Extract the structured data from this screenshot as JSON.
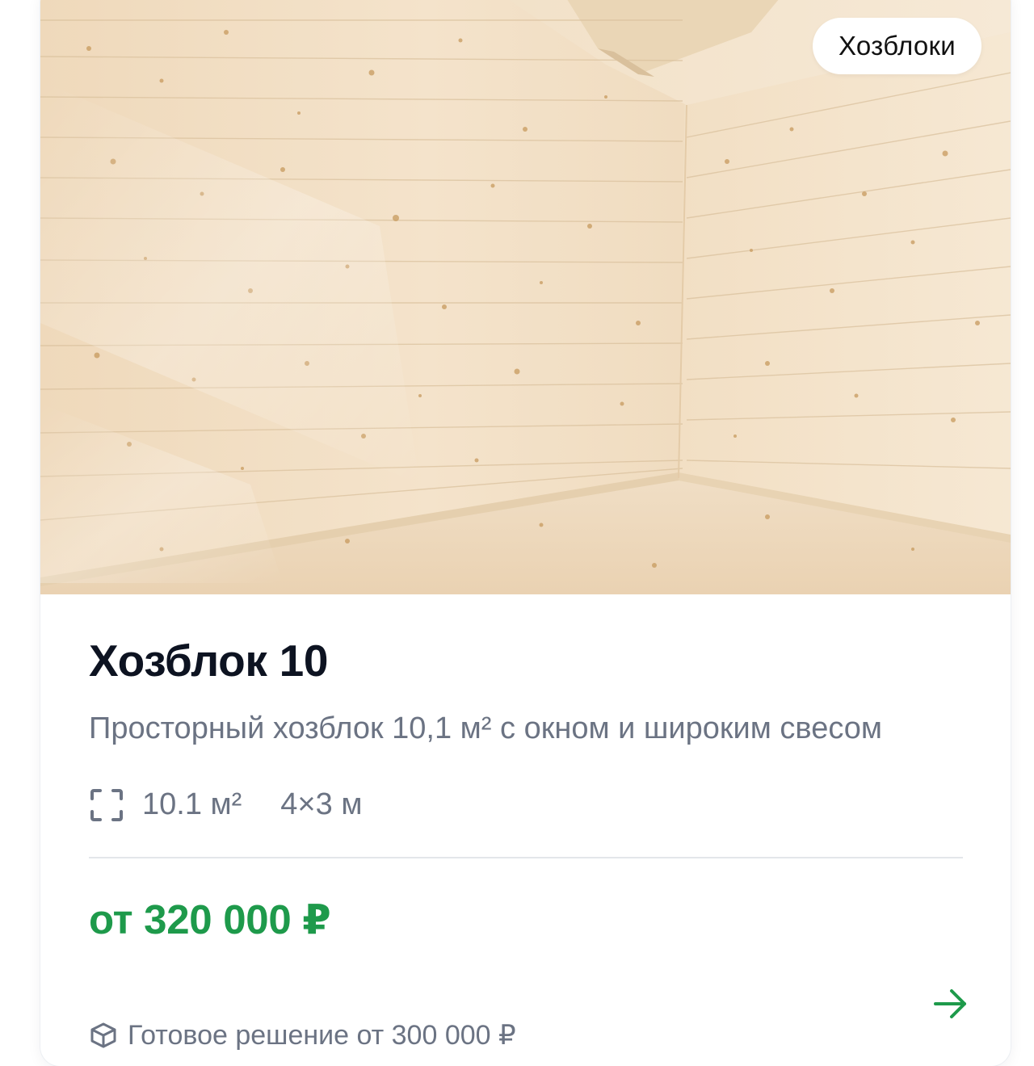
{
  "card": {
    "category_badge": "Хозблоки",
    "title": "Хозблок 10",
    "description": "Просторный хозблок 10,1 м² с окном и широким свесом",
    "specs": {
      "area_icon": "expand-corners-icon",
      "area": "10.1 м²",
      "dimensions": "4×3 м"
    },
    "price": "от 320 000 ₽",
    "ready_icon": "box-icon",
    "ready_solution": "Готовое решение от 300 000 ₽",
    "arrow_icon": "arrow-right-icon"
  },
  "colors": {
    "price": "#1e9a4b",
    "muted_text": "#6b7383",
    "title": "#0d1321",
    "wood": "#f1e0c6"
  }
}
